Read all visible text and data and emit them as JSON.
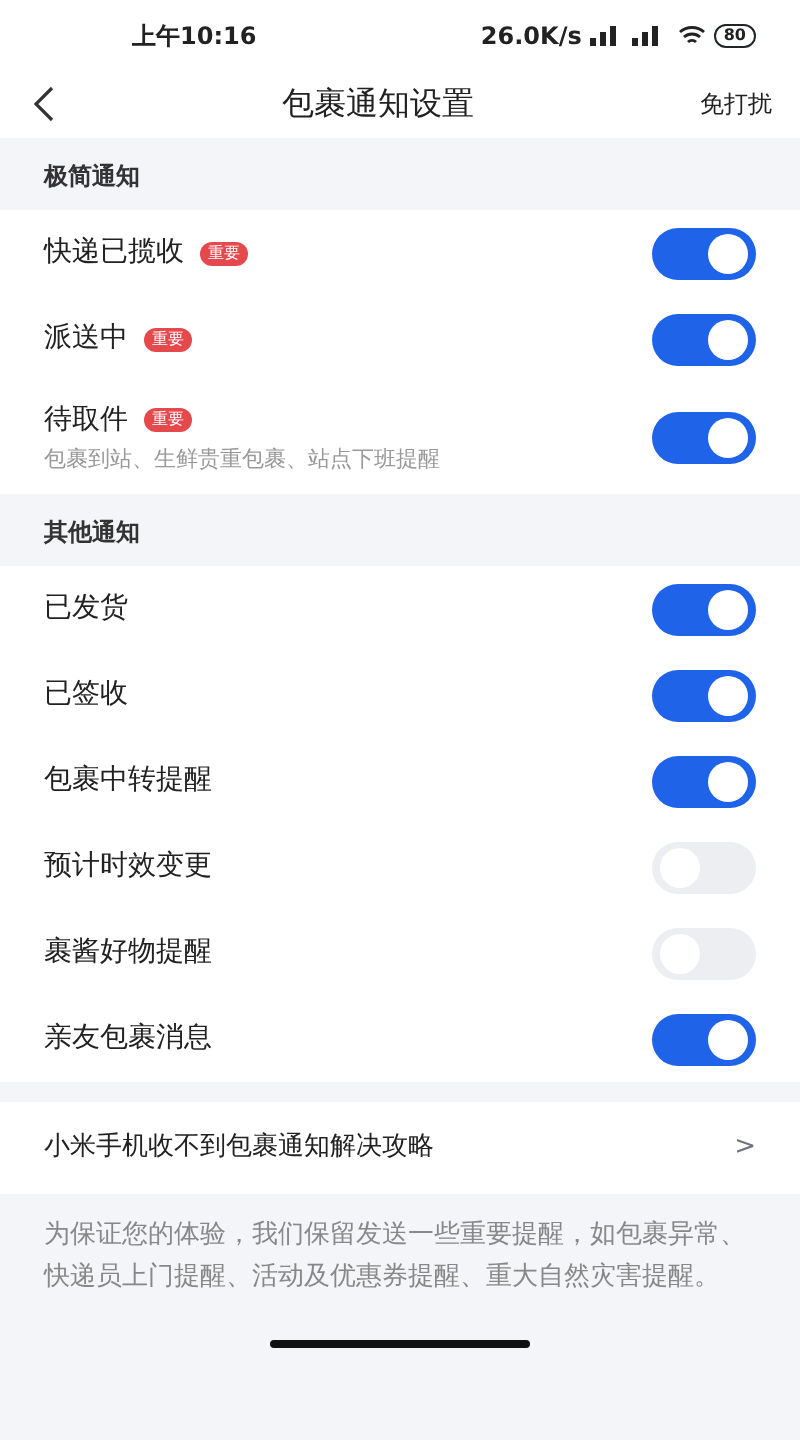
{
  "status_bar": {
    "time": "上午10:16",
    "speed": "26.0K/s",
    "battery": "80"
  },
  "header": {
    "title": "包裹通知设置",
    "action": "免打扰"
  },
  "sections": [
    {
      "title": "极简通知",
      "items": [
        {
          "label": "快递已揽收",
          "badge": "重要",
          "on": true
        },
        {
          "label": "派送中",
          "badge": "重要",
          "on": true
        },
        {
          "label": "待取件",
          "badge": "重要",
          "description": "包裹到站、生鲜贵重包裹、站点下班提醒",
          "on": true
        }
      ]
    },
    {
      "title": "其他通知",
      "items": [
        {
          "label": "已发货",
          "on": true
        },
        {
          "label": "已签收",
          "on": true
        },
        {
          "label": "包裹中转提醒",
          "on": true
        },
        {
          "label": "预计时效变更",
          "on": false
        },
        {
          "label": "裹酱好物提醒",
          "on": false
        },
        {
          "label": "亲友包裹消息",
          "on": true
        }
      ]
    }
  ],
  "link": {
    "label": "小米手机收不到包裹通知解决攻略",
    "chevron": ">"
  },
  "footnote": "为保证您的体验，我们保留发送一些重要提醒，如包裹异常、快递员上门提醒、活动及优惠券提醒、重大自然灾害提醒。"
}
